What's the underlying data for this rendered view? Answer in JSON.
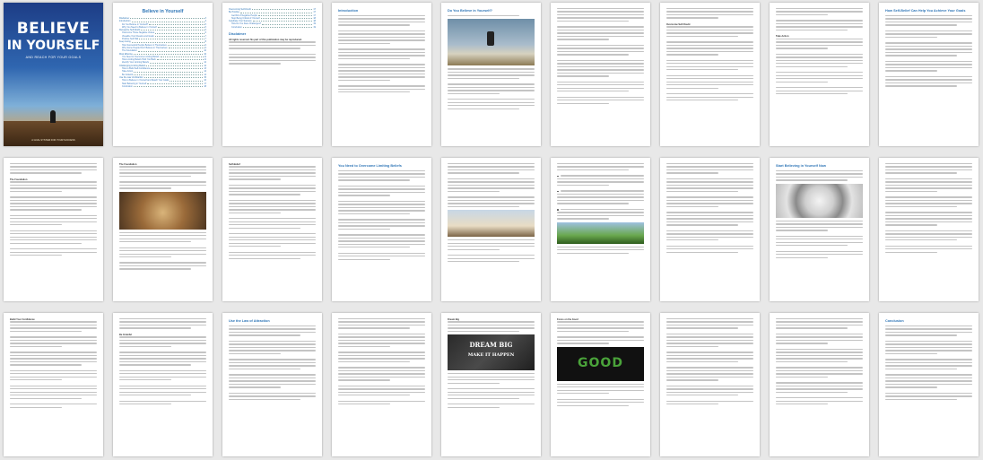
{
  "document": {
    "cover": {
      "title_line1": "BELIEVE",
      "title_line2": "IN YOURSELF",
      "subtitle": "AND REACH FOR YOUR GOALS",
      "footer": "A GOAL SYSTEM FOR YOUR SUCCESS"
    },
    "toc": {
      "title": "Believe in Yourself",
      "entries": [
        {
          "label": "Disclaimer",
          "page": "3"
        },
        {
          "label": "Introduction",
          "page": "4"
        },
        {
          "label": "Do You Believe in Yourself?",
          "page": "5"
        },
        {
          "label": "Why You Need to Believe in Yourself",
          "page": "5"
        },
        {
          "label": "Recognize Self-Doubt",
          "page": "6"
        },
        {
          "label": "Overcome Those Negative Voices",
          "page": "6"
        },
        {
          "label": "Visualize Your Dreams and Goals",
          "page": "7"
        },
        {
          "label": "Positive Self-Talk",
          "page": "7"
        },
        {
          "label": "Keep Going",
          "page": "8"
        },
        {
          "label": "How Successful People Believe in Themselves",
          "page": "9"
        },
        {
          "label": "Why Some People Don't Believe in Themselves",
          "page": "9"
        },
        {
          "label": "The Foundation",
          "page": "10"
        },
        {
          "label": "Most Effective",
          "page": "10"
        },
        {
          "label": "You Need to Overcome Limiting Beliefs",
          "page": "11"
        },
        {
          "label": "How Limiting Beliefs Hold You Back",
          "page": "11"
        },
        {
          "label": "Identify Your Limiting Beliefs",
          "page": "12"
        },
        {
          "label": "Challenging Limiting Beliefs",
          "page": "12"
        },
        {
          "label": "How to Build Self-Confidence",
          "page": "13"
        },
        {
          "label": "Take Action",
          "page": "14"
        },
        {
          "label": "Be Grateful",
          "page": "14"
        },
        {
          "label": "Use the Law of Attraction",
          "page": "15"
        },
        {
          "label": "How to Believe in Yourself and Reach Your Goals",
          "page": "16"
        },
        {
          "label": "Start Believing in Yourself",
          "page": "17"
        },
        {
          "label": "Conclusion",
          "page": "18"
        }
      ]
    },
    "toc2": {
      "entries": [
        {
          "label": "Overcoming Self-Doubt",
          "page": "17"
        },
        {
          "label": "Be Positive",
          "page": "17"
        },
        {
          "label": "Get Rid of Negative People",
          "page": "17"
        },
        {
          "label": "Stop Being Critical of Yourself",
          "page": "18"
        },
        {
          "label": "Celebrate Your Success",
          "page": "18"
        },
        {
          "label": "How Do You Face Challenges?",
          "page": "19"
        },
        {
          "label": "Conclusion",
          "page": "19"
        }
      ],
      "disclaimer_heading": "Disclaimer",
      "disclaimer_bold": "All rights reserved. No part of this publication may be reproduced."
    },
    "headings": {
      "introduction": "Introduction",
      "do_you_believe": "Do You Believe in Yourself?",
      "foundation": "The Foundation",
      "self_belief": "Self-Belief",
      "limiting_beliefs": "You Need to Overcome Limiting Beliefs",
      "start_believing": "Start Believing in Yourself Now",
      "how_self_belief": "How Self-Belief Can Help You Achieve Your Goals",
      "take_action": "Take Action",
      "confidence": "Build Your Confidence",
      "law_of_attraction": "Use the Law of Attraction",
      "be_grateful": "Be Grateful",
      "conclusion": "Conclusion",
      "self_doubt": "Overcome Self-Doubt",
      "dream_big": "Dream Big",
      "good": "Focus on the Good"
    },
    "images": {
      "dream_big_text": "DREAM BIG",
      "make_it_happen_text": "MAKE IT HAPPEN",
      "good_text": "GOOD"
    },
    "colors": {
      "heading": "#2e75b6",
      "cover_top": "#1d3d86",
      "paper": "#ffffff",
      "background": "#e8e8e8"
    }
  }
}
